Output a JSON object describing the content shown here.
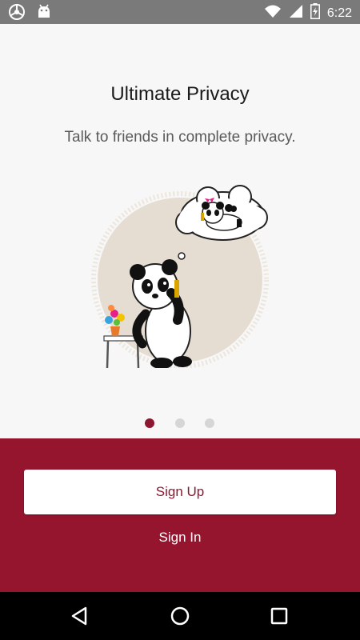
{
  "status_bar": {
    "time": "6:22",
    "icons": [
      "app-notification-icon",
      "android-icon",
      "wifi-icon",
      "signal-icon",
      "battery-charging-icon"
    ]
  },
  "onboarding": {
    "title": "Ultimate Privacy",
    "subtitle": "Talk to friends in complete privacy.",
    "illustration": "panda-phone-call-illustration",
    "page_indicator": {
      "total": 3,
      "current": 1
    }
  },
  "actions": {
    "signup_label": "Sign Up",
    "signin_label": "Sign In"
  },
  "nav_bar": {
    "icons": [
      "back-icon",
      "home-icon",
      "recents-icon"
    ]
  },
  "colors": {
    "brand": "#95152f",
    "brand_text": "#8e1631",
    "background": "#f7f7f7",
    "status_bar": "#7a7a7a"
  }
}
